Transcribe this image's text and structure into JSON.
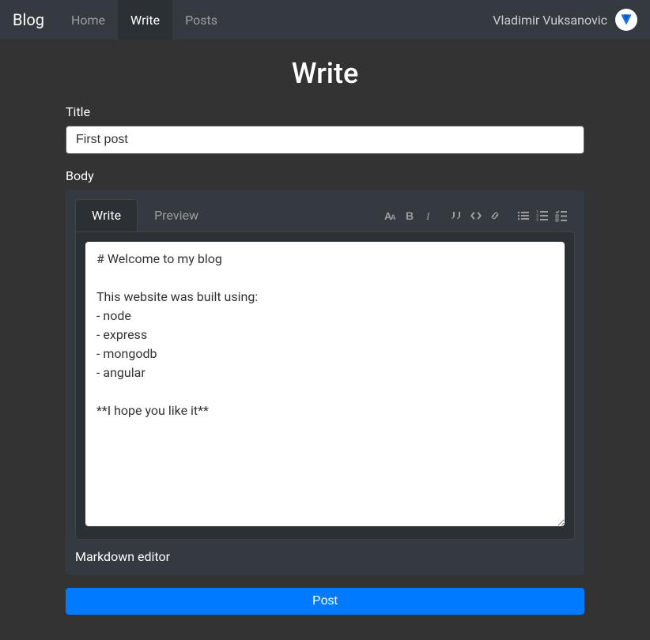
{
  "navbar": {
    "brand": "Blog",
    "links": [
      {
        "label": "Home",
        "active": false
      },
      {
        "label": "Write",
        "active": true
      },
      {
        "label": "Posts",
        "active": false
      }
    ],
    "username": "Vladimir Vuksanovic"
  },
  "page": {
    "title": "Write"
  },
  "form": {
    "title_label": "Title",
    "title_value": "First post",
    "body_label": "Body",
    "post_button": "Post"
  },
  "editor": {
    "tabs": {
      "write": "Write",
      "preview": "Preview"
    },
    "body_value": "# Welcome to my blog\n\nThis website was built using:\n- node\n- express\n- mongodb\n- angular\n\n**I hope you like it**",
    "footer": "Markdown editor"
  }
}
